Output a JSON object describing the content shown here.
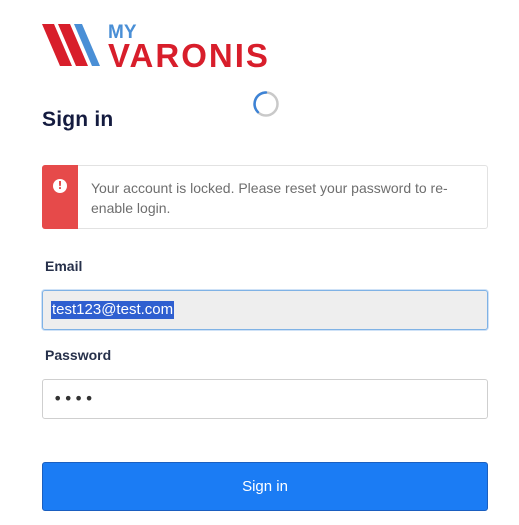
{
  "logo": {
    "prefix": "MY",
    "name": "VARONIS",
    "prefix_color": "#4a8fd6",
    "name_color": "#d81e2b"
  },
  "page_title": "Sign in",
  "alert": {
    "icon": "exclamation-circle-icon",
    "message": "Your account is locked. Please reset your password to re-enable login.",
    "color": "#e64a4a"
  },
  "form": {
    "email_label": "Email",
    "email_value": "test123@test.com",
    "password_label": "Password",
    "password_value": "••••",
    "submit_label": "Sign in"
  },
  "colors": {
    "primary_button": "#1b7cf4",
    "title_text": "#141b3f"
  }
}
